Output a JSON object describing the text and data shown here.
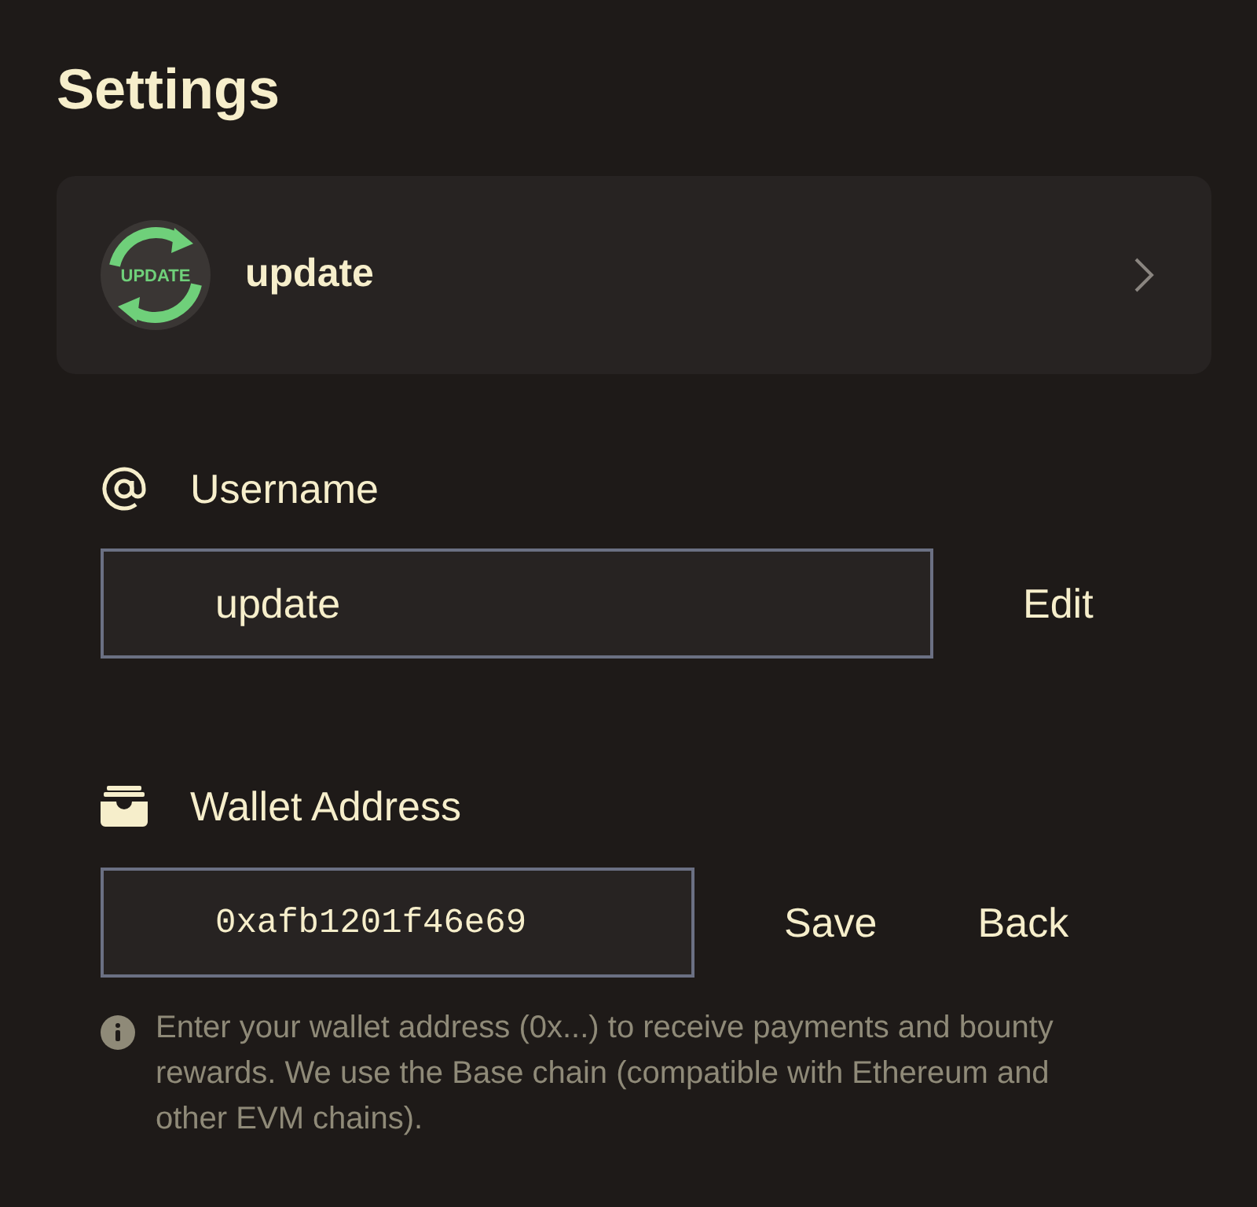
{
  "page": {
    "title": "Settings"
  },
  "profile_card": {
    "avatar_text": "UPDATE",
    "name": "update"
  },
  "username": {
    "label": "Username",
    "value": "update",
    "action": "Edit"
  },
  "wallet": {
    "label": "Wallet Address",
    "value": "0xafb1201f46e69",
    "actions": [
      "Save",
      "Back"
    ],
    "info": "Enter your wallet address (0x...) to receive payments and bounty rewards. We use the Base chain (compatible with Ethereum and other EVM chains)."
  }
}
